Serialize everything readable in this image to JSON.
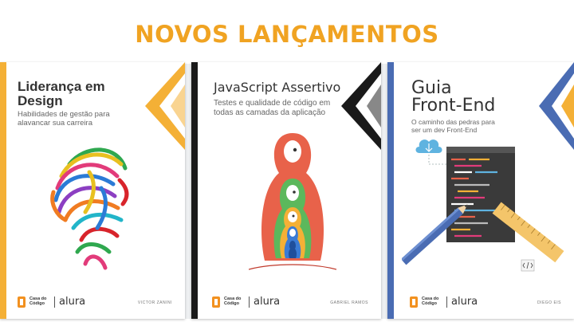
{
  "headline": "NOVOS LANÇAMENTOS",
  "colors": {
    "accent": "#f0a322",
    "book1_spine": "#f4b036",
    "book2_spine": "#1a1a1a",
    "book3_spine": "#4a6cb3"
  },
  "books": [
    {
      "title": "Liderança em Design",
      "subtitle": "Habilidades de gestão para alavancar sua carreira",
      "author": "VICTOR ZANINI",
      "brand_box": "Casa do Código",
      "brand": "alura",
      "art": "colorful-head-illustration"
    },
    {
      "title": "JavaScript Assertivo",
      "subtitle": "Testes e qualidade de código em todas as camadas da aplicação",
      "author": "GABRIEL RAMOS",
      "brand_box": "Casa do Código",
      "brand": "alura",
      "art": "nesting-dolls-illustration"
    },
    {
      "title": "Guia Front-End",
      "subtitle": "O caminho das pedras para ser um dev Front-End",
      "author": "DIEGO EIS",
      "brand_box": "Casa do Código",
      "brand": "alura",
      "art": "code-editor-ruler-pencil-illustration"
    }
  ]
}
